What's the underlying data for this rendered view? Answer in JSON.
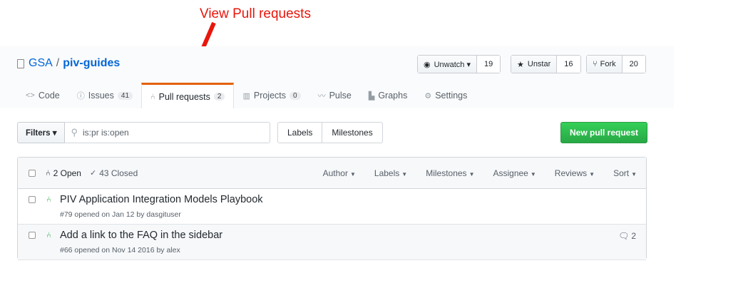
{
  "annotation": {
    "text": "View Pull requests"
  },
  "repo": {
    "owner": "GSA",
    "separator": "/",
    "name": "piv-guides"
  },
  "actions": {
    "watch": {
      "label": "Unwatch ▾",
      "count": "19"
    },
    "star": {
      "label": "Unstar",
      "count": "16"
    },
    "fork": {
      "label": "Fork",
      "count": "20"
    }
  },
  "tabs": [
    {
      "label": "Code",
      "icon": "code-icon"
    },
    {
      "label": "Issues",
      "counter": "41",
      "icon": "issue-icon"
    },
    {
      "label": "Pull requests",
      "counter": "2",
      "icon": "pull-request-icon"
    },
    {
      "label": "Projects",
      "counter": "0",
      "icon": "project-icon"
    },
    {
      "label": "Pulse",
      "icon": "pulse-icon"
    },
    {
      "label": "Graphs",
      "icon": "graph-icon"
    },
    {
      "label": "Settings",
      "icon": "gear-icon"
    }
  ],
  "filters": {
    "button": "Filters ▾",
    "query": "is:pr is:open"
  },
  "label_buttons": {
    "labels": "Labels",
    "milestones": "Milestones"
  },
  "new_pr": "New pull request",
  "states": {
    "open": "2 Open",
    "closed": "43 Closed"
  },
  "sorters": [
    "Author",
    "Labels",
    "Milestones",
    "Assignee",
    "Reviews",
    "Sort"
  ],
  "pulls": [
    {
      "title": "PIV Application Integration Models Playbook",
      "meta": "#79 opened on Jan 12 by dasgituser",
      "comments": ""
    },
    {
      "title": "Add a link to the FAQ in the sidebar",
      "meta": "#66 opened on Nov 14 2016 by alex",
      "comments": "2"
    }
  ],
  "colors": {
    "accent_orange": "#e36209",
    "annotation_red": "#e8160c",
    "green": "#28a745",
    "link_blue": "#0366d6"
  }
}
